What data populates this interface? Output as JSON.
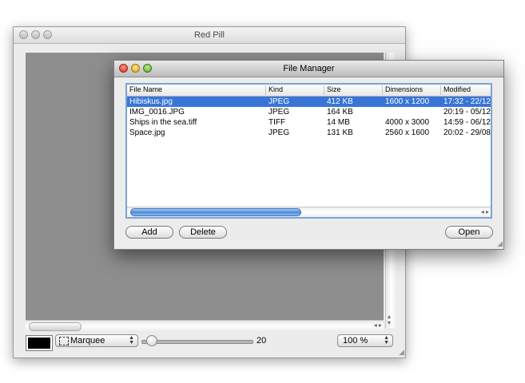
{
  "back_window": {
    "title": "Red Pill",
    "tool_label": "Marquee",
    "slider_value": "20",
    "slider_fraction": 0.08,
    "zoom_label": "100 %",
    "color_well": "#000000"
  },
  "file_manager": {
    "title": "File Manager",
    "columns": [
      "File Name",
      "Kind",
      "Size",
      "Dimensions",
      "Modified"
    ],
    "rows": [
      {
        "name": "Hibiskus.jpg",
        "kind": "JPEG",
        "size": "412 KB",
        "dimensions": "1600 x 1200",
        "modified": "17:32 - 22/12",
        "selected": true
      },
      {
        "name": "IMG_0016.JPG",
        "kind": "JPEG",
        "size": "164 KB",
        "dimensions": "",
        "modified": "20:19 - 05/12",
        "selected": false
      },
      {
        "name": "Ships in the sea.tiff",
        "kind": "TIFF",
        "size": "14 MB",
        "dimensions": "4000 x 3000",
        "modified": "14:59 - 06/12",
        "selected": false
      },
      {
        "name": "Space.jpg",
        "kind": "JPEG",
        "size": "131 KB",
        "dimensions": "2560 x 1600",
        "modified": "20:02 - 29/08",
        "selected": false
      }
    ],
    "add_label": "Add",
    "delete_label": "Delete",
    "open_label": "Open"
  },
  "colors": {
    "selection": "#3875d7",
    "focus_ring": "#7aa3d6",
    "canvas": "#8e8e8e"
  }
}
